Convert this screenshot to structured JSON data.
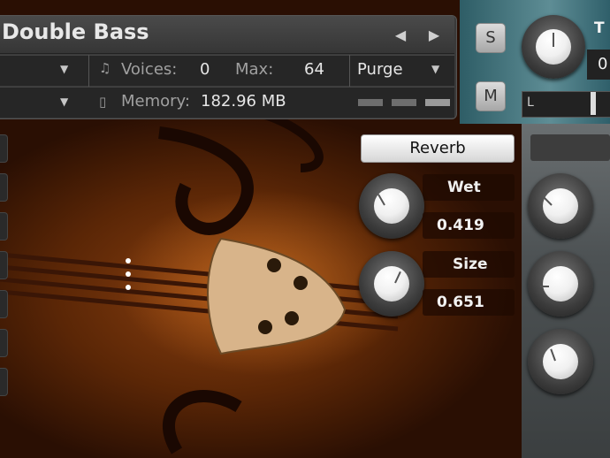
{
  "header": {
    "title": "Double Bass",
    "voices_label": "Voices:",
    "voices_value": "0",
    "max_label": "Max:",
    "max_value": "64",
    "purge_label": "Purge",
    "memory_label": "Memory:",
    "memory_value": "182.96 MB"
  },
  "buttons": {
    "solo": "S",
    "mute": "M"
  },
  "right_edge": {
    "tune_label_partial": "T",
    "tune_value_partial": "0",
    "slider_left_label": "L"
  },
  "reverb": {
    "title": "Reverb",
    "wet_label": "Wet",
    "wet_value": "0.419",
    "size_label": "Size",
    "size_value": "0.651"
  },
  "colors": {
    "panel": "#3a3a3a",
    "accent_teal": "#5e8d95",
    "text": "#e8e8e8"
  }
}
